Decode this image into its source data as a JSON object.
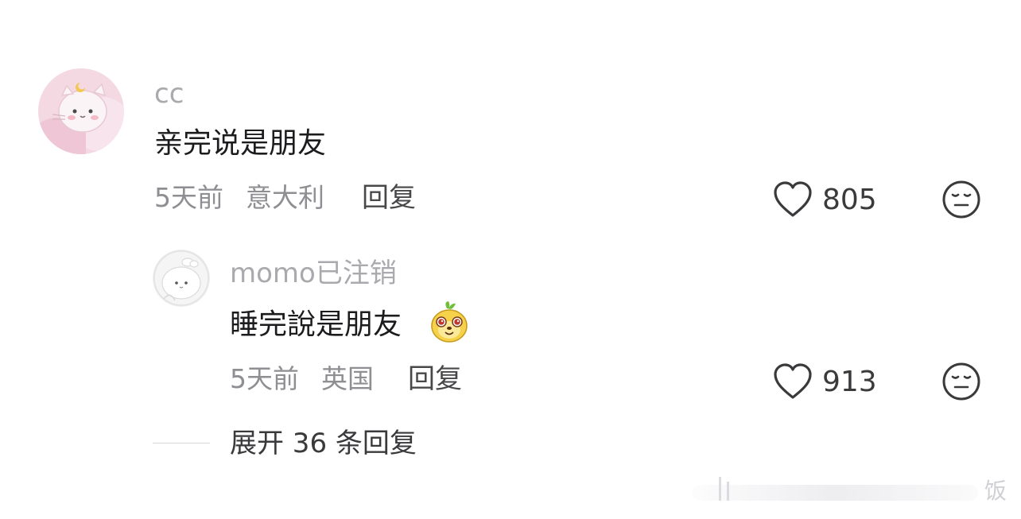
{
  "comment": {
    "username": "cc",
    "text": "亲完说是朋友",
    "time": "5天前",
    "location": "意大利",
    "reply_label": "回复",
    "likes": "805",
    "avatar_icon": "cartoon-cat-avatar",
    "like_icon": "heart-outline-icon",
    "dislike_icon": "meh-face-icon"
  },
  "reply": {
    "username": "momo已注销",
    "text": "睡完說是朋友",
    "emoji_icon": "cute-dog-emoji",
    "time": "5天前",
    "location": "英国",
    "reply_label": "回复",
    "likes": "913",
    "avatar_icon": "white-bunny-avatar",
    "like_icon": "heart-outline-icon",
    "dislike_icon": "meh-face-icon"
  },
  "expand": {
    "label": "展开 36 条回复"
  },
  "watermark": {
    "text": "饭"
  },
  "colors": {
    "username": "#a9a9ae",
    "text": "#1c1c1e",
    "meta": "#8e8e93",
    "icon": "#3a3a3c",
    "avatar_main_bg": "#f4d9e3",
    "avatar_reply_bg": "#f0f0f0"
  }
}
